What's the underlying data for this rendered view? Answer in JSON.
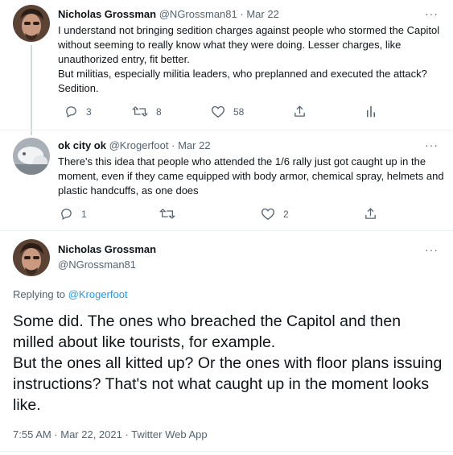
{
  "tweet1": {
    "name": "Nicholas Grossman",
    "handle": "@NGrossman81",
    "date": "Mar 22",
    "text": "I understand not bringing sedition charges against people who stormed the Capitol without seeming to really know what they were doing. Lesser charges, like unauthorized entry, fit better.\nBut militias, especially militia leaders, who preplanned and executed the attack? Sedition.",
    "replies": "3",
    "retweets": "8",
    "likes": "58"
  },
  "tweet2": {
    "name": "ok city ok",
    "handle": "@Krogerfoot",
    "date": "Mar 22",
    "text": "There's this idea that people who attended the 1/6 rally just got caught up in the moment, even if they came equipped with body armor, chemical spray, helmets and plastic handcuffs, as one does",
    "replies": "1",
    "likes": "2"
  },
  "main": {
    "name": "Nicholas Grossman",
    "handle": "@NGrossman81",
    "replying_prefix": "Replying to ",
    "replying_to": "@Krogerfoot",
    "text": "Some did. The ones who breached the Capitol and then milled about like tourists, for example.\nBut the ones all kitted up? Or the ones with floor plans issuing instructions? That's not what caught up in the moment looks like.",
    "timestamp": "7:55 AM · Mar 22, 2021 · Twitter Web App"
  },
  "separator": "·",
  "more": "···",
  "icons": [
    "reply-icon",
    "retweet-icon",
    "like-icon",
    "share-icon",
    "analytics-icon",
    "more-icon"
  ],
  "colors": {
    "link": "#1d9bf0",
    "secondary": "#536471",
    "text": "#0f1419"
  }
}
